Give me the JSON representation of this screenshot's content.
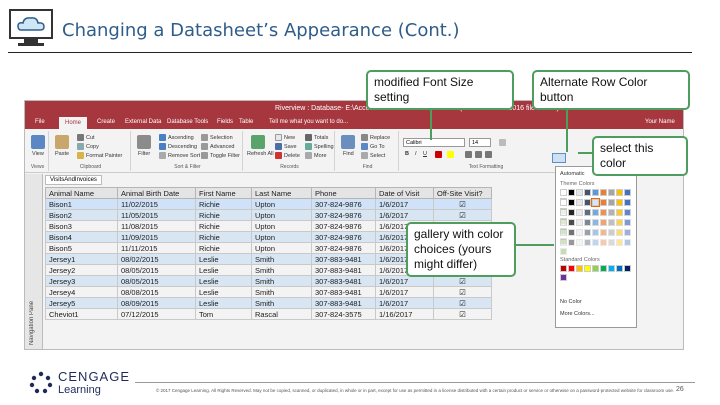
{
  "slide": {
    "title": "Changing a Datasheet’s Appearance (Cont.)",
    "page_number": "26",
    "copyright": "© 2017 Cengage Learning. All Rights Reserved. May not be copied, scanned, or duplicated, in whole or in part, except for use as permitted in a license distributed with a certain product or service or otherwise on a password-protected website for classroom use.",
    "logo": {
      "line1": "CENGAGE",
      "line2": "Learning"
    }
  },
  "window": {
    "title": "Riverview : Database- E:\\Access1\\Module\\Riverview.accdb (Access 2007 - 2016 file format) - Access",
    "user": "Your Name",
    "tabs": [
      "File",
      "Home",
      "Create",
      "External Data",
      "Database Tools",
      "Fields",
      "Table"
    ],
    "tell_me": "Tell me what you want to do...",
    "groups": {
      "views": "Views",
      "clipboard": "Clipboard",
      "sort_filter": "Sort & Filter",
      "records": "Records",
      "find": "Find",
      "text_formatting": "Text Formatting"
    },
    "buttons": {
      "view": "View",
      "paste": "Paste",
      "cut": "Cut",
      "copy": "Copy",
      "format_painter": "Format Painter",
      "filter": "Filter",
      "ascending": "Ascending",
      "descending": "Descending",
      "remove_sort": "Remove Sort",
      "selection": "Selection",
      "advanced": "Advanced",
      "toggle_filter": "Toggle Filter",
      "refresh_all": "Refresh All",
      "new": "New",
      "save": "Save",
      "delete": "Delete",
      "totals": "Totals",
      "spelling": "Spelling",
      "more": "More",
      "find": "Find",
      "replace": "Replace",
      "goto": "Go To",
      "select": "Select"
    },
    "font_name": "Calibri",
    "font_size": "14",
    "nav_pane_label": "Navigation Pane",
    "table_tab": "VisitsAndInvoices"
  },
  "datasheet": {
    "columns": [
      "Animal Name",
      "Animal Birth Date",
      "First Name",
      "Last Name",
      "Phone",
      "Date of Visit",
      "Off-Site Visit?"
    ],
    "rows": [
      [
        "Bison1",
        "11/02/2015",
        "Richie",
        "Upton",
        "307-824-9876",
        "1/6/2017",
        "☑"
      ],
      [
        "Bison2",
        "11/05/2015",
        "Richie",
        "Upton",
        "307-824-9876",
        "1/6/2017",
        "☑"
      ],
      [
        "Bison3",
        "11/08/2015",
        "Richie",
        "Upton",
        "307-824-9876",
        "1/6/2017",
        "☑"
      ],
      [
        "Bison4",
        "11/09/2015",
        "Richie",
        "Upton",
        "307-824-9876",
        "1/6/2017",
        "☑"
      ],
      [
        "Bison5",
        "11/11/2015",
        "Richie",
        "Upton",
        "307-824-9876",
        "1/6/2017",
        "☑"
      ],
      [
        "Jersey1",
        "08/02/2015",
        "Leslie",
        "Smith",
        "307-883-9481",
        "1/6/2017",
        "☑"
      ],
      [
        "Jersey2",
        "08/05/2015",
        "Leslie",
        "Smith",
        "307-883-9481",
        "1/6/2017",
        "☑"
      ],
      [
        "Jersey3",
        "08/05/2015",
        "Leslie",
        "Smith",
        "307-883-9481",
        "1/6/2017",
        "☑"
      ],
      [
        "Jersey4",
        "08/08/2015",
        "Leslie",
        "Smith",
        "307-883-9481",
        "1/6/2017",
        "☑"
      ],
      [
        "Jersey5",
        "08/09/2015",
        "Leslie",
        "Smith",
        "307-883-9481",
        "1/6/2017",
        "☑"
      ],
      [
        "Cheviot1",
        "07/12/2015",
        "Tom",
        "Rascal",
        "307-824-3575",
        "1/16/2017",
        "☑"
      ]
    ]
  },
  "palette": {
    "automatic": "Automatic",
    "theme_colors": "Theme Colors",
    "standard_colors": "Standard Colors",
    "no_color": "No Color",
    "more_colors": "More Colors...",
    "theme_row": [
      "#ffffff",
      "#000000",
      "#e7e6e6",
      "#44546a",
      "#5b9bd5",
      "#ed7d31",
      "#a5a5a5",
      "#ffc000",
      "#4472c4",
      "#70ad47"
    ],
    "standard_row": [
      "#c00000",
      "#ff0000",
      "#ffc000",
      "#ffff00",
      "#92d050",
      "#00b050",
      "#00b0f0",
      "#0070c0",
      "#002060",
      "#7030a0"
    ],
    "selected_color": "#d8e6f3"
  },
  "callouts": {
    "font_size": "modified Font Size setting",
    "alt_row": "Alternate Row Color button",
    "select_color": "select this color",
    "gallery": "gallery with color choices (yours might differ)"
  },
  "colors": {
    "title_bar": "#a6373f",
    "callout_border": "#4f9c5f",
    "alternate_row": "#d8e6f3"
  }
}
